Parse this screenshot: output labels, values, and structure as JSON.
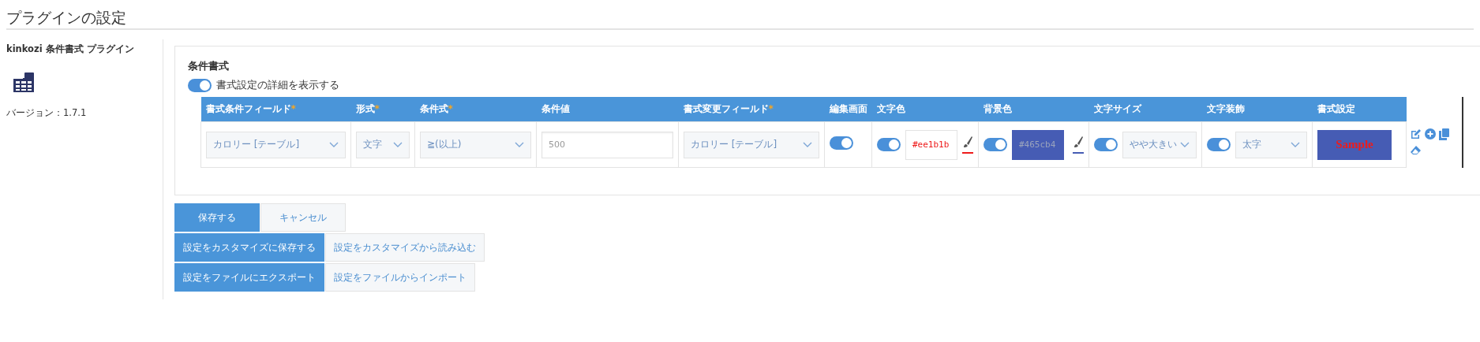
{
  "page_title": "プラグインの設定",
  "plugin": {
    "name": "kinkozi 条件書式 プラグイン",
    "version": "バージョン：1.7.1"
  },
  "section": {
    "title": "条件書式",
    "details_toggle": {
      "label": "書式設定の詳細を表示する",
      "on": true
    }
  },
  "table": {
    "columns": [
      {
        "label": "書式条件フィールド",
        "required_mark": "*"
      },
      {
        "label": "形式",
        "required_mark": "*"
      },
      {
        "label": "条件式",
        "required_mark": "*"
      },
      {
        "label": "条件値"
      },
      {
        "label": "書式変更フィールド",
        "required_mark": "*"
      },
      {
        "label": "編集画面"
      },
      {
        "label": "文字色"
      },
      {
        "label": "背景色"
      },
      {
        "label": "文字サイズ"
      },
      {
        "label": "文字装飾"
      },
      {
        "label": "書式設定"
      }
    ],
    "rows": [
      {
        "cells": [
          {
            "kind": "select",
            "value": "カロリー [テーブル]"
          },
          {
            "kind": "select",
            "value": "文字"
          },
          {
            "kind": "select",
            "value": "≧(以上)"
          },
          {
            "kind": "input",
            "placeholder": "500"
          },
          {
            "kind": "select",
            "value": "カロリー [テーブル]"
          },
          {
            "kind": "toggle",
            "on": true
          },
          {
            "kind": "text_color",
            "on": true,
            "value": "#ee1b1b",
            "color": "#ee1b1b"
          },
          {
            "kind": "bg_color",
            "on": true,
            "value": "#465cb4",
            "color": "#465cb4"
          },
          {
            "kind": "toggle_select",
            "on": true,
            "value": "やや大きい"
          },
          {
            "kind": "toggle_select",
            "on": true,
            "value": "太字"
          },
          {
            "kind": "sample",
            "text": "Sample"
          }
        ]
      }
    ]
  },
  "button_rows": [
    [
      {
        "label": "保存する",
        "kind": "primary"
      },
      {
        "label": "キャンセル",
        "kind": "secondary"
      }
    ],
    [
      {
        "label": "設定をカスタマイズに保存する",
        "kind": "primary"
      },
      {
        "label": "設定をカスタマイズから読み込む",
        "kind": "secondary"
      }
    ],
    [
      {
        "label": "設定をファイルにエクスポート",
        "kind": "primary"
      },
      {
        "label": "設定をファイルからインポート",
        "kind": "secondary"
      }
    ]
  ]
}
